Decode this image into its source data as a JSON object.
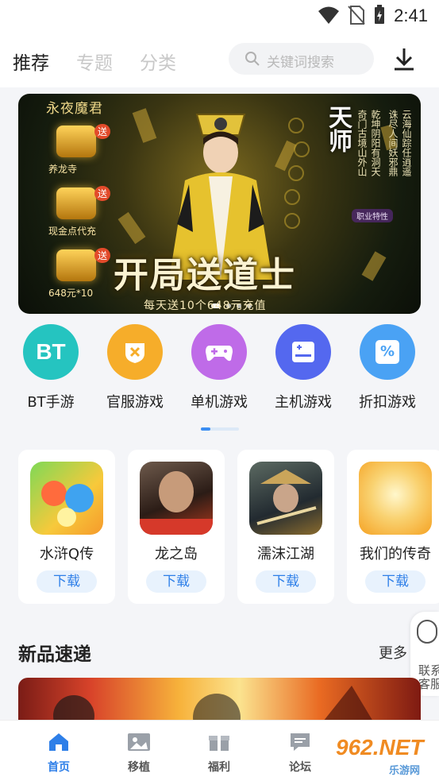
{
  "status_bar": {
    "time": "2:41"
  },
  "header": {
    "tabs": [
      {
        "label": "推荐",
        "active": true
      },
      {
        "label": "专题",
        "active": false
      },
      {
        "label": "分类",
        "active": false
      }
    ],
    "search_placeholder": "关键词搜索",
    "download_icon": "download-icon"
  },
  "banner": {
    "corner_title": "永夜魔君",
    "rewards": [
      {
        "badge": "送",
        "label": "养龙寺"
      },
      {
        "badge": "送",
        "label": "现金点代充"
      },
      {
        "badge": "送",
        "label": "648元*10"
      }
    ],
    "vertical_title": "天师",
    "verse_1": "奇门古境山外山",
    "verse_2": "乾坤阴阳有洞天",
    "verse_3": "诛尽人间妖邪鼎",
    "verse_4": "云海仙踪任逍遥",
    "job_tag": "职业特性",
    "headline": "开局送道士",
    "subline": "每天送10个648元充值",
    "slide_count": 4,
    "active_slide": 0
  },
  "categories": [
    {
      "label": "BT手游",
      "color": "#25c4c0",
      "icon": "bt-icon",
      "glyph": "BT"
    },
    {
      "label": "官服游戏",
      "color": "#f6ad2a",
      "icon": "shield-icon",
      "glyph": ""
    },
    {
      "label": "单机游戏",
      "color": "#bf6be8",
      "icon": "gamepad-icon",
      "glyph": ""
    },
    {
      "label": "主机游戏",
      "color": "#5468ef",
      "icon": "console-icon",
      "glyph": ""
    },
    {
      "label": "折扣游戏",
      "color": "#4aa2f4",
      "icon": "discount-icon",
      "glyph": "%"
    }
  ],
  "games": [
    {
      "name": "水浒Q传",
      "button": "下载",
      "colors": [
        "#7ed957",
        "#f7c93b"
      ]
    },
    {
      "name": "龙之岛",
      "button": "下载",
      "colors": [
        "#3a2a26",
        "#e0622c"
      ]
    },
    {
      "name": "濡沫江湖",
      "button": "下载",
      "colors": [
        "#2c3b46",
        "#d9b365"
      ]
    },
    {
      "name": "我们的传奇",
      "button": "下载",
      "colors": [
        "#f9d271",
        "#f5a223"
      ]
    }
  ],
  "section": {
    "title": "新品速递",
    "more": "更多"
  },
  "contact": {
    "label": "联系客服"
  },
  "tabbar": [
    {
      "label": "首页",
      "icon": "home-icon",
      "active": true
    },
    {
      "label": "移植",
      "icon": "transfer-icon",
      "active": false
    },
    {
      "label": "福利",
      "icon": "gift-icon",
      "active": false
    },
    {
      "label": "论坛",
      "icon": "forum-icon",
      "active": false
    }
  ],
  "watermark": {
    "brand": "962.NET",
    "sub": "乐游网"
  },
  "colors": {
    "accent": "#2e7fe8",
    "background": "#f4f5f8"
  }
}
